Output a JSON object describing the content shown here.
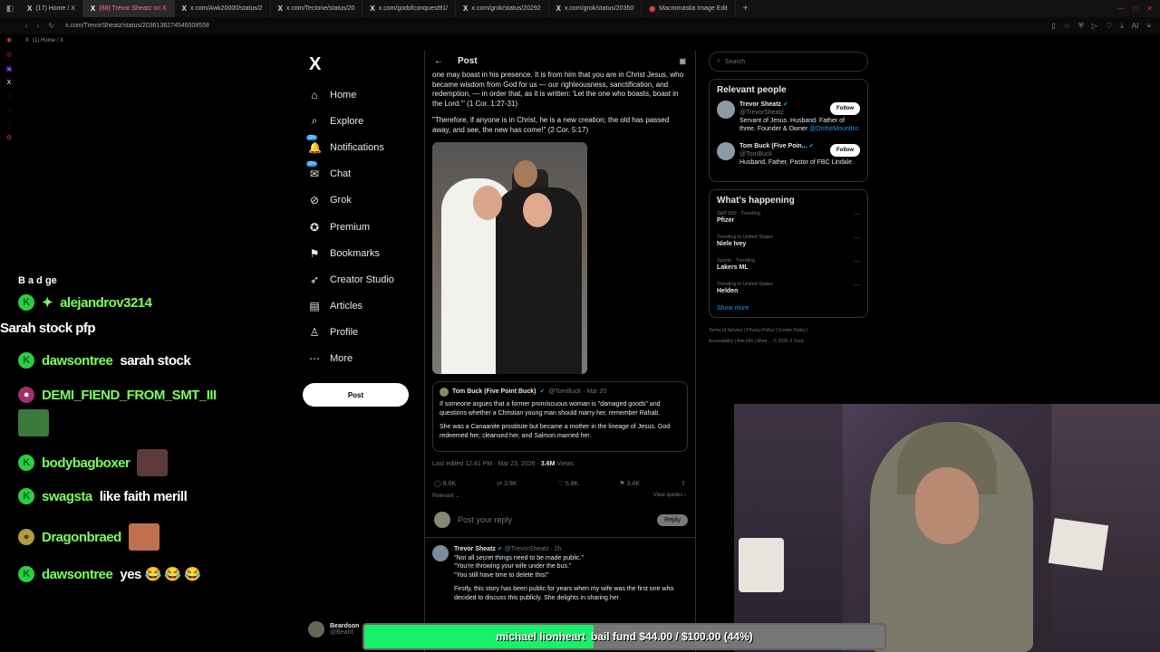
{
  "browser": {
    "tabs": [
      {
        "label": "(17) Home / X",
        "active": false
      },
      {
        "label": "(88) Trevor Sheatz on X",
        "active": true
      },
      {
        "label": "x.com/Awk20000/status/2",
        "active": false
      },
      {
        "label": "x.com/Tectone/status/20",
        "active": false
      },
      {
        "label": "x.com/godofconquest91/",
        "active": false
      },
      {
        "label": "x.com/grok/status/20292",
        "active": false
      },
      {
        "label": "x.com/grok/status/20350",
        "active": false
      },
      {
        "label": "Macromastia Image Edit",
        "active": false
      }
    ],
    "url": "x.com/TrevorSheatz/status/2036136274546008558",
    "bookmark": "(1) Home / X"
  },
  "chat": {
    "stack_text": "B a d ge",
    "messages": [
      {
        "user": "alejandrov3214",
        "badge": "K",
        "badge_style": "green",
        "text": ""
      },
      {
        "user": "",
        "badge": "",
        "badge_style": "none",
        "text": "Sarah stock pfp"
      },
      {
        "user": "dawsontree",
        "badge": "K",
        "badge_style": "green",
        "text": "sarah stock"
      },
      {
        "user": "DEMI_FIEND_FROM_SMT_III",
        "badge": "●",
        "badge_style": "pink",
        "text": ""
      },
      {
        "user": "bodybagboxer",
        "badge": "K",
        "badge_style": "green",
        "text": ""
      },
      {
        "user": "swagsta",
        "badge": "K",
        "badge_style": "green",
        "text": "like faith merill"
      },
      {
        "user": "Dragonbraed",
        "badge": "●",
        "badge_style": "olive",
        "text": ""
      },
      {
        "user": "dawsontree",
        "badge": "K",
        "badge_style": "green",
        "text": "yes 😂 😂 😂"
      }
    ]
  },
  "xnav": {
    "logo": "X",
    "items": [
      {
        "label": "Home",
        "icon": "home-icon",
        "glyph": "⌂"
      },
      {
        "label": "Explore",
        "icon": "search-icon",
        "glyph": "⌕"
      },
      {
        "label": "Notifications",
        "icon": "bell-icon",
        "glyph": "🔔",
        "badge": "20+"
      },
      {
        "label": "Chat",
        "icon": "mail-icon",
        "glyph": "✉",
        "badge": "20+"
      },
      {
        "label": "Grok",
        "icon": "grok-icon",
        "glyph": "⊘"
      },
      {
        "label": "Premium",
        "icon": "verified-icon",
        "glyph": "✪"
      },
      {
        "label": "Bookmarks",
        "icon": "bookmark-icon",
        "glyph": "⚑"
      },
      {
        "label": "Creator Studio",
        "icon": "rocket-icon",
        "glyph": "➶"
      },
      {
        "label": "Articles",
        "icon": "document-icon",
        "glyph": "▤"
      },
      {
        "label": "Profile",
        "icon": "person-icon",
        "glyph": "♙"
      },
      {
        "label": "More",
        "icon": "more-icon",
        "glyph": "⋯"
      }
    ],
    "post_button": "Post",
    "account_name": "Beardson",
    "account_handle": "@Beard"
  },
  "post": {
    "header": "Post",
    "paragraph1": "one may boast in his presence. It is from him that you are in Christ Jesus, who became wisdom from God for us — our righteousness, sanctification, and redemption, — in order that, as it is written: 'Let the one who boasts, boast in the Lord.'\" (1 Cor. 1:27-31)",
    "paragraph2": "\"Therefore, if anyone is in Christ, he is a new creation; the old has passed away, and see, the new has come!\" (2 Cor. 5:17)",
    "quote": {
      "name": "Tom Buck (Five Point Buck)",
      "handle": "@TomBuck · Mar 20",
      "p1": "If someone argues that a former promiscuous woman is \"damaged goods\" and questions whether a Christian young man should marry her, remember Rahab.",
      "p2": "She was a Canaanite prostitute but became a mother in the lineage of Jesus. God redeemed her, cleansed her, and Salmon married her."
    },
    "meta": "Last edited 12:41 PM · Mar 23, 2026 · ",
    "views": "3.6M",
    "views_label": " Views",
    "actions": {
      "replies": "8.6K",
      "reposts": "3.8K",
      "likes": "5.8K",
      "bookmarks": "3.4K"
    },
    "relevant": "Relevant ⌄",
    "view_quotes": "View quotes ›",
    "reply_placeholder": "Post your reply",
    "reply_button": "Reply",
    "reply": {
      "name": "Trevor Sheatz",
      "handle": "@TrevorSheatz · 2h",
      "lines": [
        "\"Not all secret things need to be made public.\"",
        "\"You're throwing your wife under the bus.\"",
        "\"You still have time to delete this!\""
      ],
      "body": "Firstly, this story has been public for years when my wife was the first one who decided to discuss this publicly. She delights in sharing her"
    }
  },
  "right": {
    "search_placeholder": "Search",
    "relevant_title": "Relevant people",
    "people": [
      {
        "name": "Trevor Sheatz",
        "handle": "@TrevorSheatz",
        "bio": "Servant of Jesus. Husband. Father of three. Founder & Owner ",
        "link": "@OntheMountInc",
        "button": "Follow"
      },
      {
        "name": "Tom Buck (Five Poin...",
        "handle": "@TomBuck",
        "bio": "Husband, Father, Pastor of FBC Lindale.",
        "link": "",
        "button": "Follow"
      }
    ],
    "happening_title": "What's happening",
    "trends": [
      {
        "category": "S&P 500 · Trending",
        "title": "Pfizer"
      },
      {
        "category": "Trending in United States",
        "title": "Niele Ivey"
      },
      {
        "category": "Sports · Trending",
        "title": "Lakers ML"
      },
      {
        "category": "Trending in United States",
        "title": "Helden"
      }
    ],
    "show_more": "Show more",
    "footer1": "Terms of Service | Privacy Policy | Cookie Policy |",
    "footer2": "Accessibility | Ads info | More ... © 2026 X Corp."
  },
  "overlay": {
    "bail_name": "michael lionheart",
    "bail_text": "bail fund $44.00 / $100.00 (44%)",
    "progress": 0.44,
    "fill_color": "#19f06a"
  }
}
